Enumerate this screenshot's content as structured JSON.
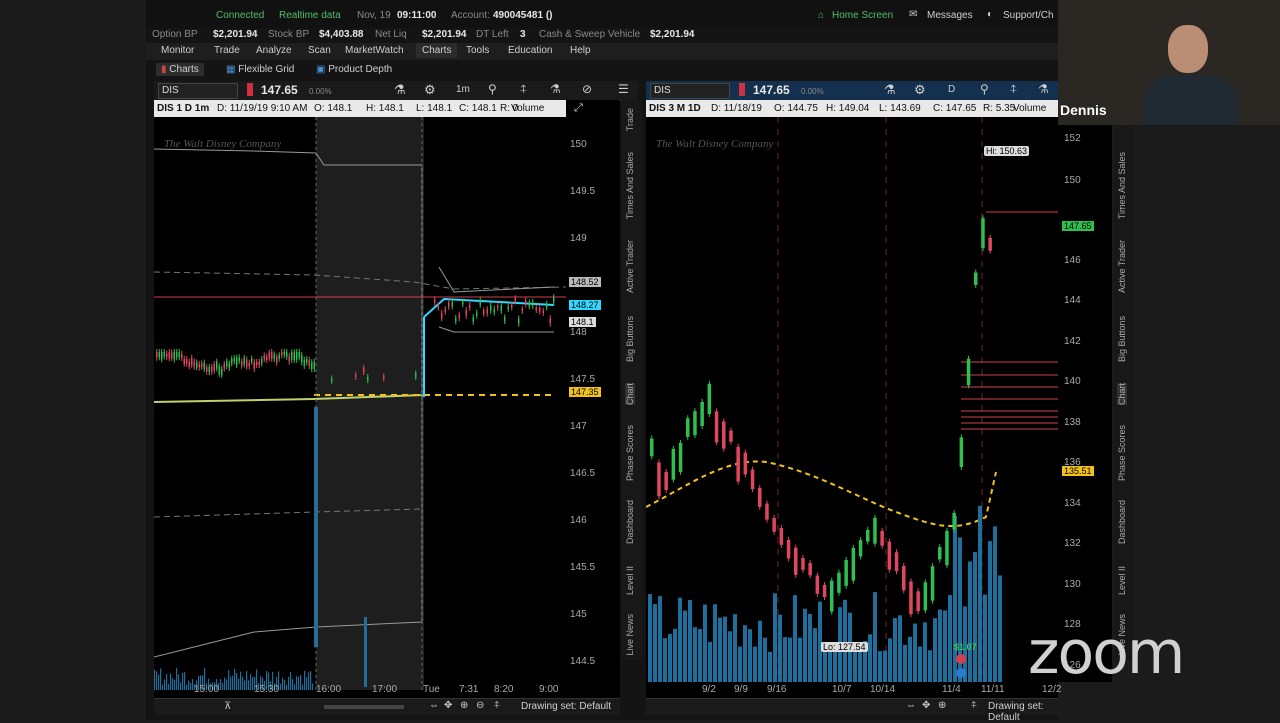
{
  "top": {
    "connection": "Connected",
    "data_feed": "Realtime data",
    "date": "Nov, 19",
    "time": "09:11:00",
    "account_label": "Account:",
    "account": "490045481 ()",
    "home_screen": "Home Screen",
    "messages": "Messages",
    "support": "Support/Ch"
  },
  "balances": [
    {
      "label": "Option BP",
      "value": "$2,201.94"
    },
    {
      "label": "Stock BP",
      "value": "$4,403.88"
    },
    {
      "label": "Net Liq",
      "value": "$2,201.94"
    },
    {
      "label": "DT Left",
      "value": "3"
    },
    {
      "label": "Cash & Sweep Vehicle",
      "value": "$2,201.94"
    }
  ],
  "menu": [
    "Monitor",
    "Trade",
    "Analyze",
    "Scan",
    "MarketWatch",
    "Charts",
    "Tools",
    "Education",
    "Help"
  ],
  "subtabs": [
    "Charts",
    "Flexible Grid",
    "Product Depth"
  ],
  "left_chart": {
    "symbol": "DIS",
    "price": "147.65",
    "change": "0.00%",
    "timeframe_btn": "1m",
    "title": "DIS 1 D 1m",
    "info": [
      "D: 11/19/19 9:10 AM",
      "O: 148.1",
      "H: 148.1",
      "L: 148.1",
      "C: 148.1",
      "R: 0"
    ],
    "volume": "Volume",
    "y_ticks": [
      "150",
      "149.5",
      "149",
      "148",
      "147.5",
      "147",
      "146.5",
      "146",
      "145.5",
      "145",
      "144.5"
    ],
    "x_ticks": [
      "15:00",
      "15:30",
      "16:00",
      "17:00",
      "Tue",
      "7:31",
      "8:20",
      "9:00"
    ],
    "tags": {
      "upper": "148.52",
      "current": "148.27",
      "lower": "148.1",
      "dash": "147.35"
    },
    "watermark": "The Walt Disney Company",
    "drawing_set": "Drawing set: Default"
  },
  "right_chart": {
    "symbol": "DIS",
    "price": "147.65",
    "change": "0.00%",
    "timeframe_btn": "D",
    "title": "DIS 3 M 1D",
    "info": [
      "D: 11/18/19",
      "O: 144.75",
      "H: 149.04",
      "L: 143.69",
      "C: 147.65",
      "R: 5.35"
    ],
    "volume": "Volume",
    "y_ticks": [
      "152",
      "150",
      "146",
      "144",
      "142",
      "140",
      "138",
      "136",
      "134",
      "132",
      "130",
      "128",
      "126"
    ],
    "x_ticks": [
      "9/2",
      "9/9",
      "9/16",
      "10/7",
      "10/14",
      "11/4",
      "11/11",
      "12/2"
    ],
    "hi": "Hi: 150.63",
    "lo": "Lo: 127.54",
    "tags": {
      "current": "147.65",
      "ma": "135.51"
    },
    "event": "$1.07",
    "watermark": "The Walt Disney Company",
    "drawing_set": "Drawing set: Default"
  },
  "side_tabs_left": [
    "Trade",
    "Times And Sales",
    "Active Trader",
    "Big Buttons",
    "Chart",
    "Phase Scores",
    "Dashboard",
    "Level II",
    "Live News"
  ],
  "side_tabs_right": [
    "Times And Sales",
    "Active Trader",
    "Big Buttons",
    "Chart",
    "Phase Scores",
    "Dashboard",
    "Level II",
    "Live News"
  ],
  "participant": "Dennis",
  "zoom": "zoom",
  "colors": {
    "up": "#2fbf4f",
    "down": "#e0475f",
    "cyan": "#2fd9ff",
    "yellow": "#f2c21b",
    "volume": "#1f6e9c"
  }
}
